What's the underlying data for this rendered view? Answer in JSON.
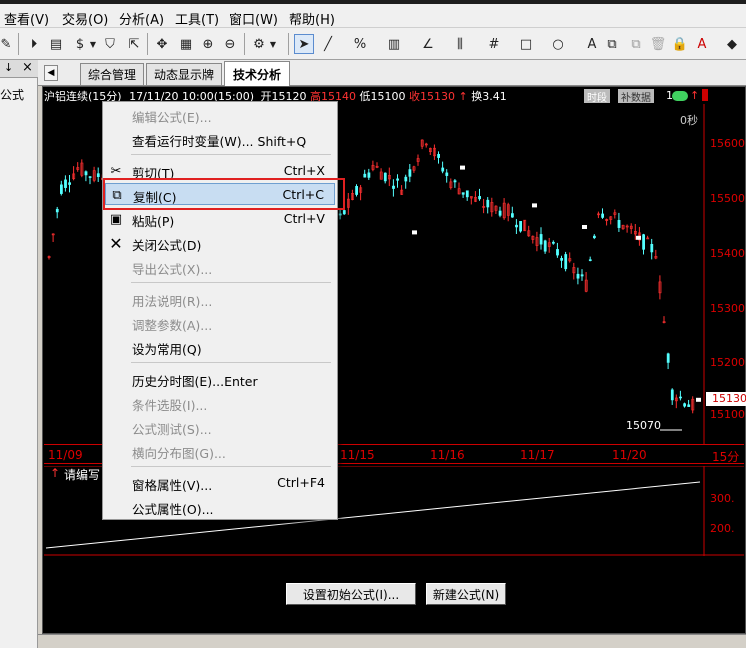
{
  "menubar": {
    "items": [
      "查看(V)",
      "交易(O)",
      "分析(A)",
      "工具(T)",
      "窗口(W)",
      "帮助(H)"
    ]
  },
  "left_panel": {
    "pin": "↓",
    "close": "×",
    "label": "公式"
  },
  "tabs": {
    "items": [
      "综合管理",
      "动态显示牌",
      "技术分析"
    ],
    "active": 2
  },
  "infobar": {
    "title": "沪铝连续",
    "period": "(15分)",
    "date": "17/11/20",
    "time": "10:00(15:00)",
    "open_label": "开",
    "open": "15120",
    "high_label": "高",
    "high": "15140",
    "low_label": "低",
    "low": "15100",
    "close_label": "收",
    "close": "15130",
    "turn_label": "换",
    "turn": "3.41",
    "badge_time": "时段",
    "badge_fill": "补数据",
    "badge_extra": "14"
  },
  "chart_data": {
    "type": "candlestick",
    "right_axis_ticks": [
      "15600",
      "15500",
      "15400",
      "15300",
      "15200",
      "15100"
    ],
    "right_axis_extra": [
      "15130",
      "0秒"
    ],
    "low_annotation": "15070",
    "x_labels": [
      "11/09",
      "11/15",
      "11/16",
      "11/17",
      "11/20",
      "15分"
    ],
    "indicator_label": "请编写",
    "indicator_ticks": [
      "300.",
      "200."
    ],
    "colors": {
      "up": "#ff3030",
      "down": "#54ffff",
      "axis": "#dd0000"
    }
  },
  "context_menu": {
    "items": [
      {
        "label": "编辑公式(E)...",
        "shortcut": "",
        "enabled": false,
        "icon": ""
      },
      {
        "label": "查看运行时变量(W)... Shift+Q",
        "shortcut": "",
        "enabled": true,
        "icon": ""
      },
      {
        "label": "剪切(T)",
        "shortcut": "Ctrl+X",
        "enabled": true,
        "icon": "scissors-icon"
      },
      {
        "label": "复制(C)",
        "shortcut": "Ctrl+C",
        "enabled": true,
        "icon": "copy-icon",
        "highlighted": true
      },
      {
        "label": "粘贴(P)",
        "shortcut": "Ctrl+V",
        "enabled": true,
        "icon": "paste-icon"
      },
      {
        "label": "关闭公式(D)",
        "shortcut": "",
        "enabled": true,
        "icon": "close-x-icon"
      },
      {
        "label": "导出公式(X)...",
        "shortcut": "",
        "enabled": false,
        "icon": ""
      },
      {
        "label": "用法说明(R)...",
        "shortcut": "",
        "enabled": false,
        "icon": ""
      },
      {
        "label": "调整参数(A)...",
        "shortcut": "",
        "enabled": false,
        "icon": ""
      },
      {
        "label": "设为常用(Q)",
        "shortcut": "",
        "enabled": true,
        "icon": ""
      },
      {
        "label": "历史分时图(E)...Enter",
        "shortcut": "",
        "enabled": true,
        "icon": ""
      },
      {
        "label": "条件选股(I)...",
        "shortcut": "",
        "enabled": false,
        "icon": ""
      },
      {
        "label": "公式测试(S)...",
        "shortcut": "",
        "enabled": false,
        "icon": ""
      },
      {
        "label": "横向分布图(G)...",
        "shortcut": "",
        "enabled": false,
        "icon": ""
      },
      {
        "label": "窗格属性(V)...",
        "shortcut": "Ctrl+F4",
        "enabled": true,
        "icon": ""
      },
      {
        "label": "公式属性(O)...",
        "shortcut": "",
        "enabled": true,
        "icon": ""
      }
    ]
  },
  "buttons": {
    "set_initial": "设置初始公式(I)...",
    "new_formula": "新建公式(N)"
  }
}
